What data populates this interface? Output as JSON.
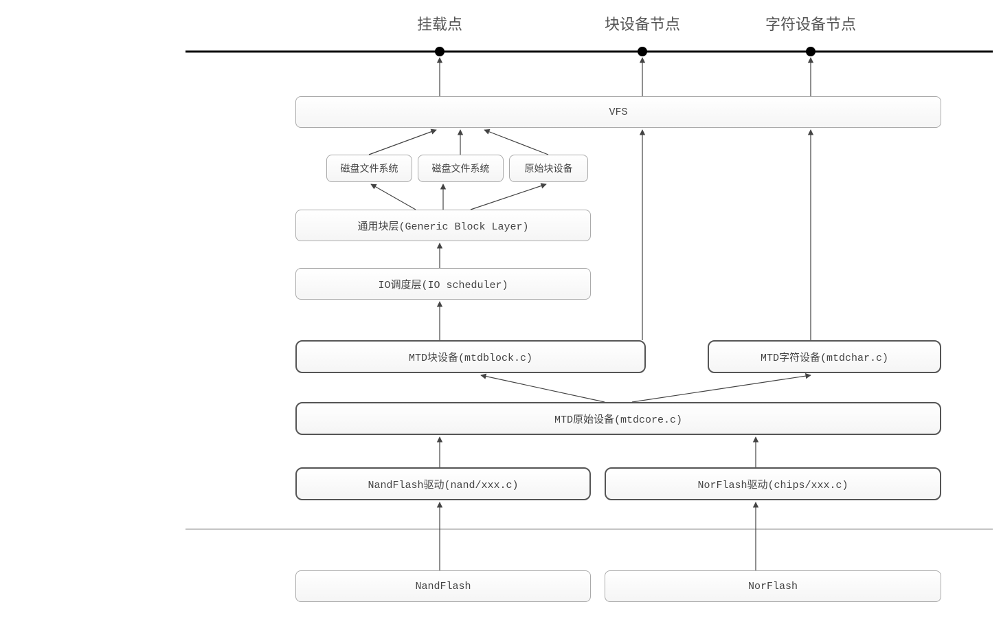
{
  "labels": {
    "mount_point": "挂载点",
    "block_dev_node": "块设备节点",
    "char_dev_node": "字符设备节点"
  },
  "boxes": {
    "vfs": "VFS",
    "disk_fs_1": "磁盘文件系统",
    "disk_fs_2": "磁盘文件系统",
    "raw_block_dev": "原始块设备",
    "generic_block_layer": "通用块层(Generic Block Layer)",
    "io_scheduler": "IO调度层(IO scheduler)",
    "mtd_block": "MTD块设备(mtdblock.c)",
    "mtd_char": "MTD字符设备(mtdchar.c)",
    "mtd_core": "MTD原始设备(mtdcore.c)",
    "nand_driver": "NandFlash驱动(nand/xxx.c)",
    "nor_driver": "NorFlash驱动(chips/xxx.c)",
    "nand_flash": "NandFlash",
    "nor_flash": "NorFlash"
  }
}
